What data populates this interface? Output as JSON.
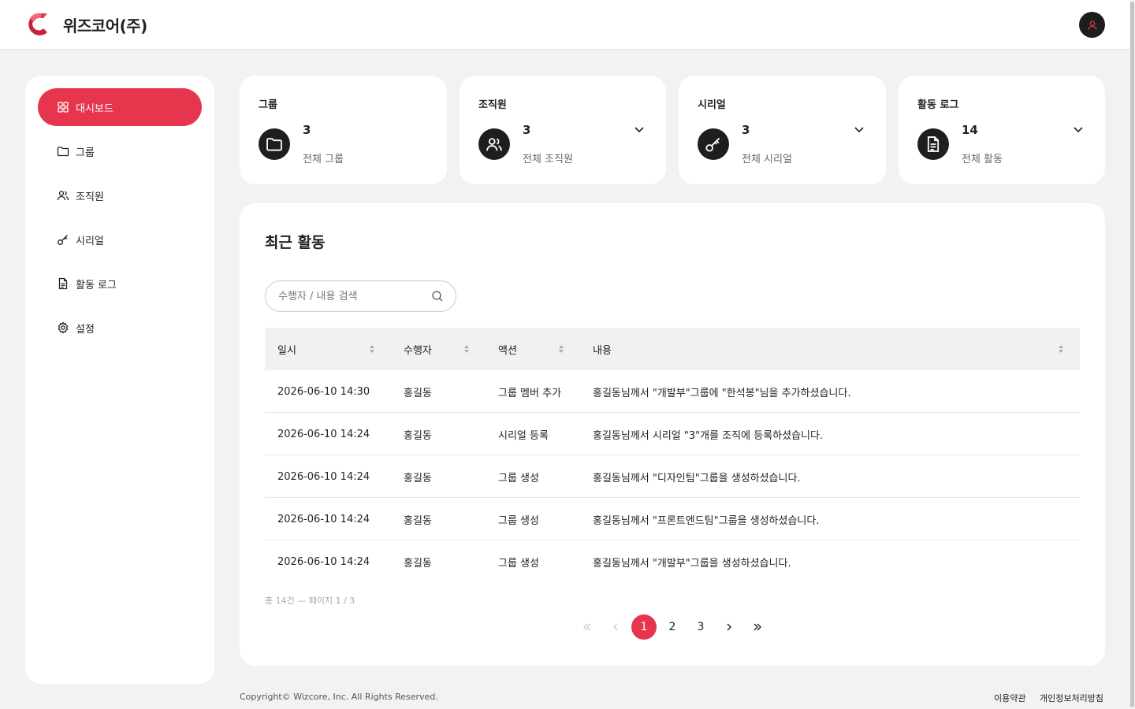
{
  "header": {
    "brand": "위즈코어(주)",
    "logo_color": "#e5364e",
    "avatar_icon": "user-icon"
  },
  "sidebar": {
    "items": [
      {
        "label": "대시보드",
        "icon": "dashboard-icon",
        "active": true
      },
      {
        "label": "그룹",
        "icon": "folder-icon",
        "active": false
      },
      {
        "label": "조직원",
        "icon": "users-icon",
        "active": false
      },
      {
        "label": "시리얼",
        "icon": "key-icon",
        "active": false
      },
      {
        "label": "활동 로그",
        "icon": "document-icon",
        "active": false
      },
      {
        "label": "설정",
        "icon": "gear-icon",
        "active": false
      }
    ]
  },
  "cards": [
    {
      "title": "그룹",
      "count": "3",
      "sub": "전체 그룹",
      "icon": "folder-icon",
      "has_dropdown": false
    },
    {
      "title": "조직원",
      "count": "3",
      "sub": "전체 조직원",
      "icon": "users-icon",
      "has_dropdown": true
    },
    {
      "title": "시리얼",
      "count": "3",
      "sub": "전체 시리얼",
      "icon": "key-icon",
      "has_dropdown": true
    },
    {
      "title": "활동 로그",
      "count": "14",
      "sub": "전체 활동",
      "icon": "document-icon",
      "has_dropdown": true
    }
  ],
  "recent": {
    "title": "최근 활동",
    "search_placeholder": "수행자 / 내용 검색",
    "columns": [
      "일시",
      "수행자",
      "액션",
      "내용"
    ],
    "rows": [
      [
        "2026-06-10 14:30",
        "홍길동",
        "그룹 멤버 추가",
        "홍길동님께서 \"개발부\"그룹에 \"한석봉\"님을 추가하셨습니다."
      ],
      [
        "2026-06-10 14:24",
        "홍길동",
        "시리얼 등록",
        "홍길동님께서 시리얼 \"3\"개를 조직에 등록하셨습니다."
      ],
      [
        "2026-06-10 14:24",
        "홍길동",
        "그룹 생성",
        "홍길동님께서 \"디자인팀\"그룹을 생성하셨습니다."
      ],
      [
        "2026-06-10 14:24",
        "홍길동",
        "그룹 생성",
        "홍길동님께서 \"프론트엔드팀\"그룹을 생성하셨습니다."
      ],
      [
        "2026-06-10 14:24",
        "홍길동",
        "그룹 생성",
        "홍길동님께서 \"개발부\"그룹을 생성하셨습니다."
      ]
    ],
    "summary": "총 14건 — 페이지 1 / 3",
    "pagination": {
      "pages": [
        "1",
        "2",
        "3"
      ],
      "current": "1"
    }
  },
  "footer": {
    "copyright": "Copyright© Wizcore, Inc. All Rights Reserved.",
    "links": [
      "이용약관",
      "개인정보처리방침"
    ]
  },
  "colors": {
    "accent": "#e5364e",
    "dark": "#1e1e1e",
    "background": "#f2f2f2"
  }
}
